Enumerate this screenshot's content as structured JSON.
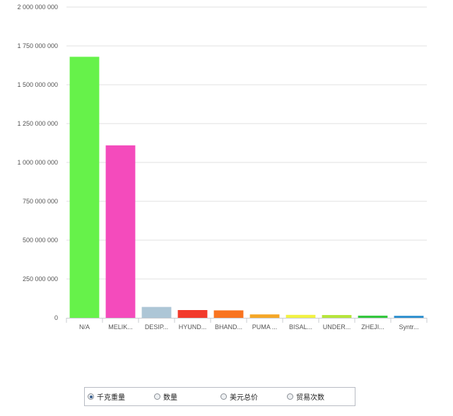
{
  "chart_data": {
    "type": "bar",
    "categories": [
      "N/A",
      "MELIK...",
      "DESIP...",
      "HYUND...",
      "BHAND...",
      "PUMA ...",
      "BISAL...",
      "UNDER...",
      "ZHEJI...",
      "Syntr..."
    ],
    "values": [
      1680000000,
      1110000000,
      70000000,
      50000000,
      48000000,
      22000000,
      19000000,
      18000000,
      14000000,
      13000000
    ],
    "colors": [
      "#66f24a",
      "#f44bbc",
      "#adc6d6",
      "#f23a2c",
      "#f97420",
      "#f5a727",
      "#f2f242",
      "#b6e53a",
      "#33c73d",
      "#2b8fcf"
    ],
    "ylim": [
      0,
      2000000000
    ],
    "yticks": [
      0,
      250000000,
      500000000,
      750000000,
      1000000000,
      1250000000,
      1500000000,
      1750000000,
      2000000000
    ],
    "ytick_labels": [
      "0",
      "250 000 000",
      "500 000 000",
      "750 000 000",
      "1 000 000 000",
      "1 250 000 000",
      "1 500 000 000",
      "1 750 000 000",
      "2 000 000 000"
    ],
    "grid": true,
    "legend": "none"
  },
  "options": [
    {
      "label": "千克重量",
      "selected": true
    },
    {
      "label": "数量",
      "selected": false
    },
    {
      "label": "美元总价",
      "selected": false
    },
    {
      "label": "贸易次数",
      "selected": false
    }
  ]
}
